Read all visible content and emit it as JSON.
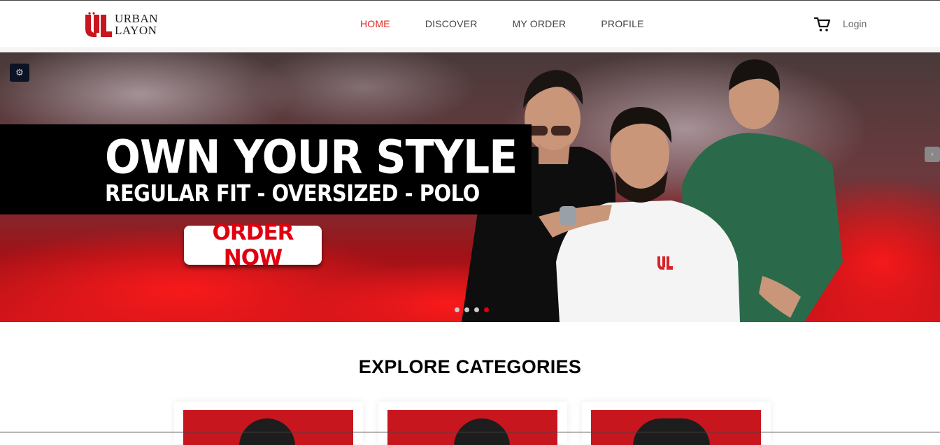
{
  "brand": {
    "name_line1": "URBAN",
    "name_line2": "LAYON",
    "mark": "UL",
    "color": "#c8161e"
  },
  "nav": {
    "items": [
      {
        "label": "HOME",
        "active": true
      },
      {
        "label": "DISCOVER",
        "active": false
      },
      {
        "label": "MY ORDER",
        "active": false
      },
      {
        "label": "PROFILE",
        "active": false
      }
    ],
    "cart_icon": "shopping-cart-icon",
    "login_label": "Login"
  },
  "hero": {
    "headline": "OWN YOUR STYLE",
    "subheadline": "REGULAR FIT - OVERSIZED - POLO",
    "cta_label": "ORDER NOW",
    "slide_count": 4,
    "active_slide": 4,
    "shirt_logo": "UL",
    "accent": "#e0000f"
  },
  "categories": {
    "title": "EXPLORE CATEGORIES"
  }
}
